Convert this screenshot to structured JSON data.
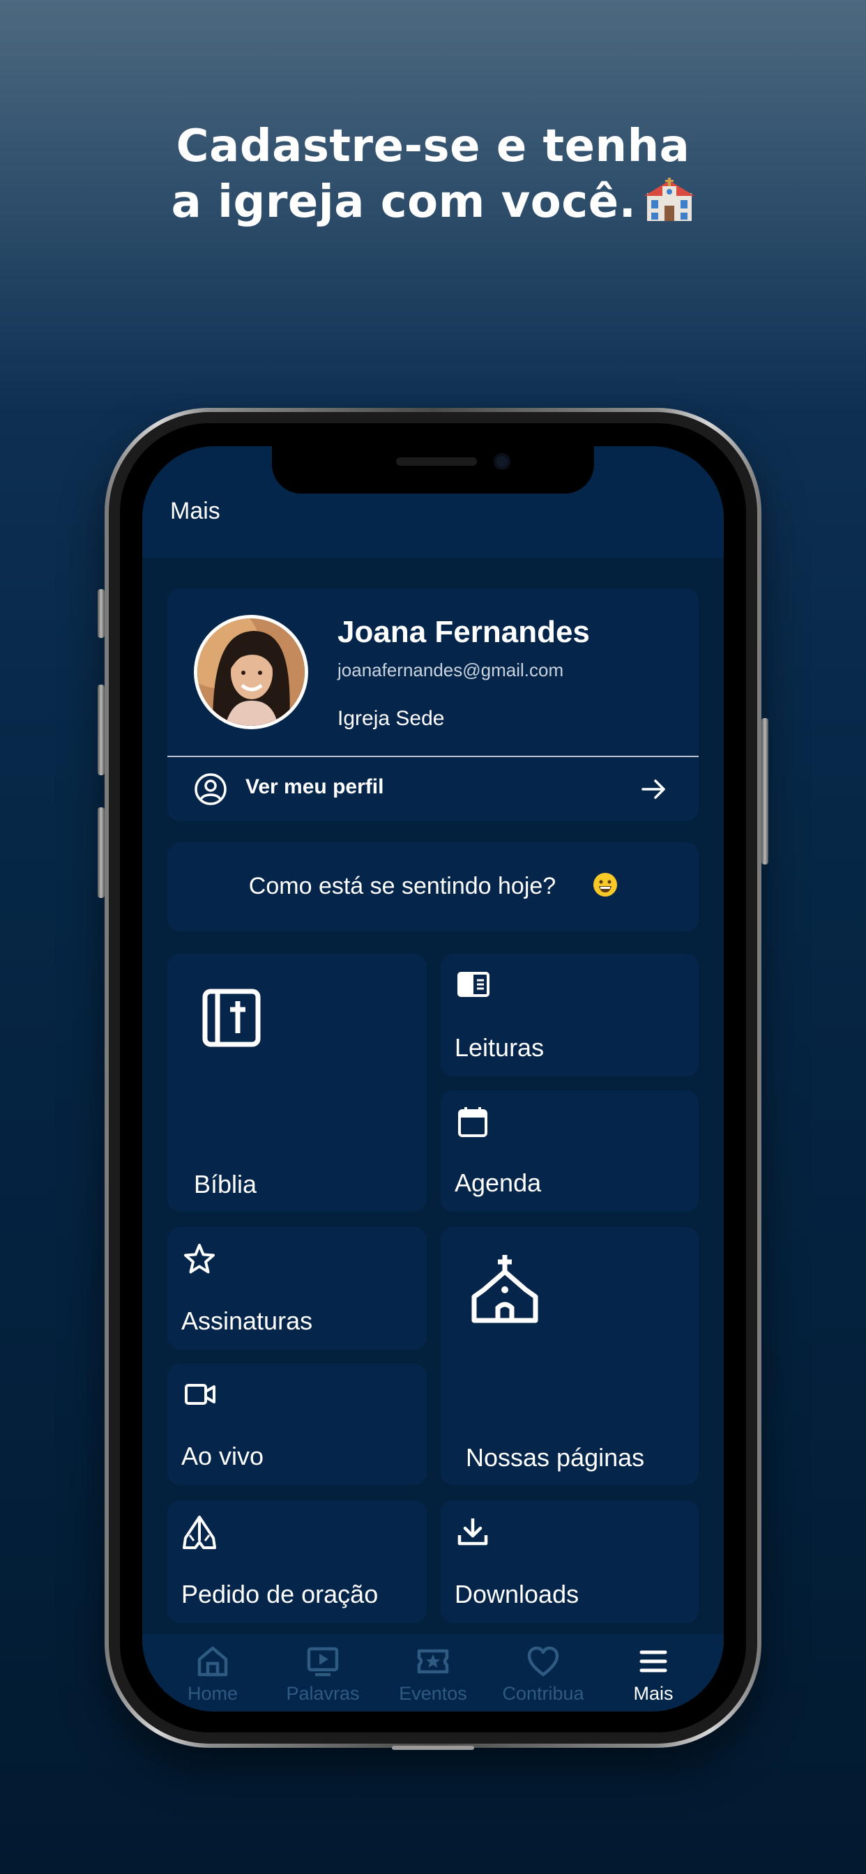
{
  "headline": {
    "line1": "Cadastre-se e tenha",
    "line2": "a igreja com você."
  },
  "header": {
    "title": "Mais"
  },
  "profile": {
    "name": "Joana Fernandes",
    "email": "joanafernandes@gmail.com",
    "church": "Igreja Sede",
    "view_profile_label": "Ver meu perfil"
  },
  "mood": {
    "prompt": "Como está se sentindo hoje?"
  },
  "tiles": {
    "biblia": "Bíblia",
    "leituras": "Leituras",
    "agenda": "Agenda",
    "assinaturas": "Assinaturas",
    "ao_vivo": "Ao vivo",
    "nossas_paginas": "Nossas páginas",
    "pedido_oracao": "Pedido de oração",
    "downloads": "Downloads"
  },
  "bottom_nav": {
    "home": "Home",
    "palavras": "Palavras",
    "eventos": "Eventos",
    "contribua": "Contribua",
    "mais": "Mais",
    "active": "Mais"
  },
  "colors": {
    "screen_bg": "#03203d",
    "card_bg": "#05264a",
    "nav_inactive": "#2f5a82",
    "nav_active": "#ffffff",
    "accent_emoji": "#f7c928"
  }
}
